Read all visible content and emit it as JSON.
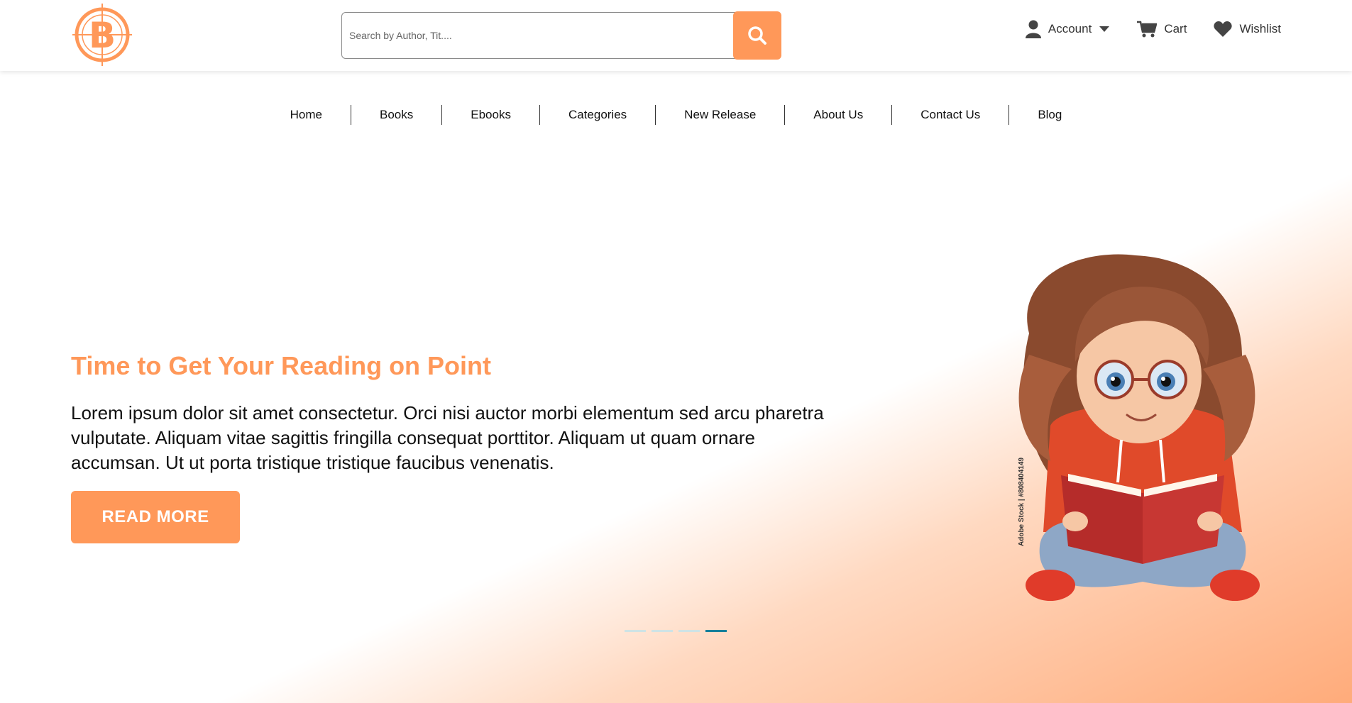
{
  "header": {
    "logo_letter": "B",
    "search_placeholder": "Search by Author, Tit....",
    "account_label": "Account",
    "cart_label": "Cart",
    "wishlist_label": "Wishlist"
  },
  "nav": {
    "items": [
      "Home",
      "Books",
      "Ebooks",
      "Categories",
      "New Release",
      "About Us",
      "Contact Us",
      "Blog"
    ]
  },
  "hero": {
    "title": "Time to Get Your Reading on Point",
    "text": "Lorem ipsum dolor sit amet consectetur. Orci nisi auctor morbi elementum sed arcu pharetra vulputate. Aliquam vitae sagittis fringilla consequat porttitor. Aliquam ut quam ornare accumsan. Ut ut porta tristique tristique faucibus venenatis.",
    "button_label": "READ MORE",
    "slides_total": 4,
    "active_slide": 4,
    "image_watermark": "Adobe Stock | #808404149"
  },
  "colors": {
    "accent": "#ff9859",
    "active_dot": "#17809b"
  }
}
